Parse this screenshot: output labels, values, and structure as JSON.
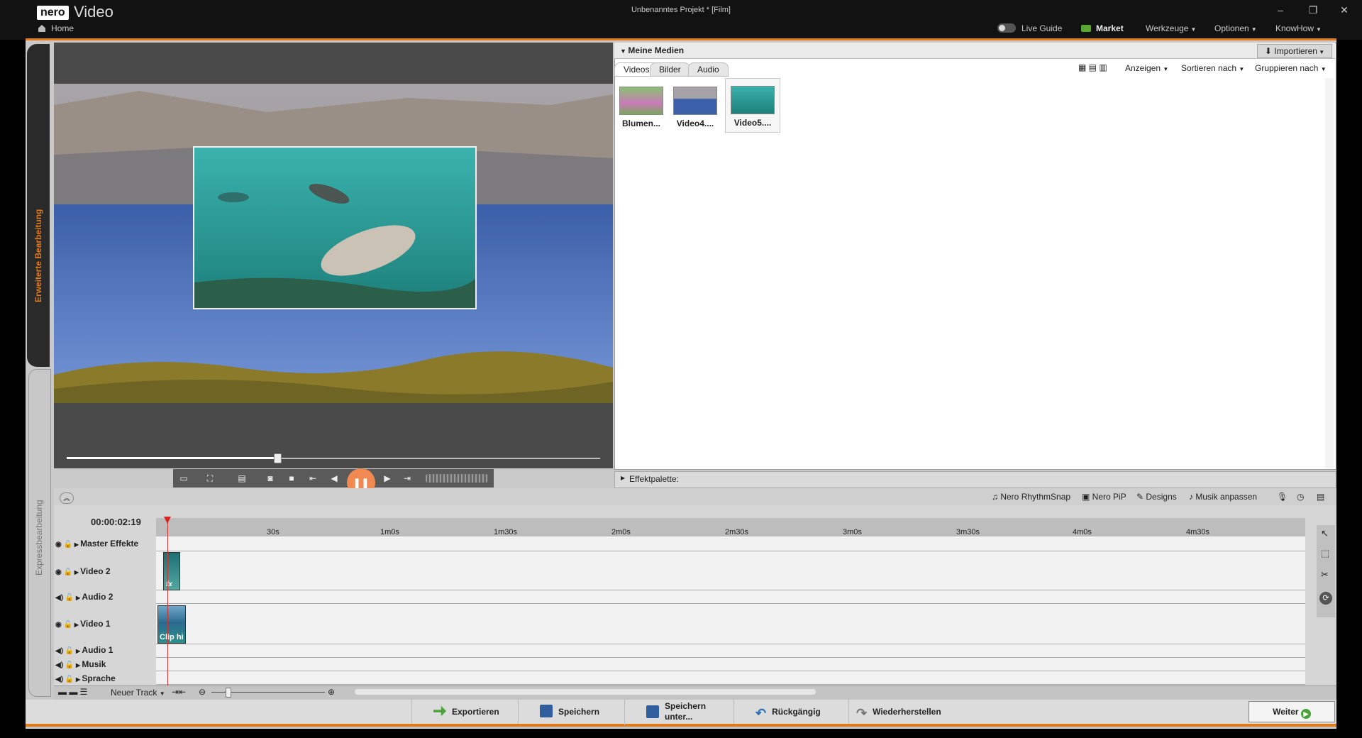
{
  "app": {
    "logo": "nero",
    "name": "Video",
    "window_title": "Unbenanntes Projekt * [Film]",
    "home": "Home"
  },
  "window_controls": {
    "minimize": "–",
    "restore": "❐",
    "close": "✕"
  },
  "menu": {
    "live_guide": "Live Guide",
    "market": "Market",
    "tools": "Werkzeuge",
    "options": "Optionen",
    "knowhow": "KnowHow"
  },
  "sidebar": {
    "advanced": "Erweiterte Bearbeitung",
    "express": "Expressbearbeitung"
  },
  "media": {
    "title": "Meine Medien",
    "import": "Importieren",
    "tabs": [
      {
        "label": "Videos"
      },
      {
        "label": "Bilder"
      },
      {
        "label": "Audio"
      }
    ],
    "toolbar": {
      "view": "Anzeigen",
      "sort": "Sortieren nach",
      "group": "Gruppieren nach"
    },
    "items": [
      {
        "label": "Blumen..."
      },
      {
        "label": "Video4...."
      },
      {
        "label": "Video5...."
      }
    ]
  },
  "effects": {
    "label": "Effektpalette:"
  },
  "timeline_toolbar": {
    "rhythmsnap": "Nero RhythmSnap",
    "pip": "Nero PiP",
    "designs": "Designs",
    "music": "Musik anpassen"
  },
  "timeline": {
    "timecode": "00:00:02:19",
    "ticks": [
      "30s",
      "1m0s",
      "1m30s",
      "2m0s",
      "2m30s",
      "3m0s",
      "3m30s",
      "4m0s",
      "4m30s"
    ],
    "tracks": [
      {
        "name": "Master Effekte"
      },
      {
        "name": "Video 2"
      },
      {
        "name": "Audio 2"
      },
      {
        "name": "Video 1"
      },
      {
        "name": "Audio 1"
      },
      {
        "name": "Musik"
      },
      {
        "name": "Sprache"
      }
    ],
    "clip_v2_label": "fx",
    "clip_v1_label": "Clip hi",
    "new_track": "Neuer Track"
  },
  "actions": {
    "export": "Exportieren",
    "save": "Speichern",
    "save_as": "Speichern unter...",
    "undo": "Rückgängig",
    "redo": "Wiederherstellen",
    "next": "Weiter"
  },
  "colors": {
    "accent": "#e07b1c",
    "pause_highlight": "#f08a52"
  }
}
